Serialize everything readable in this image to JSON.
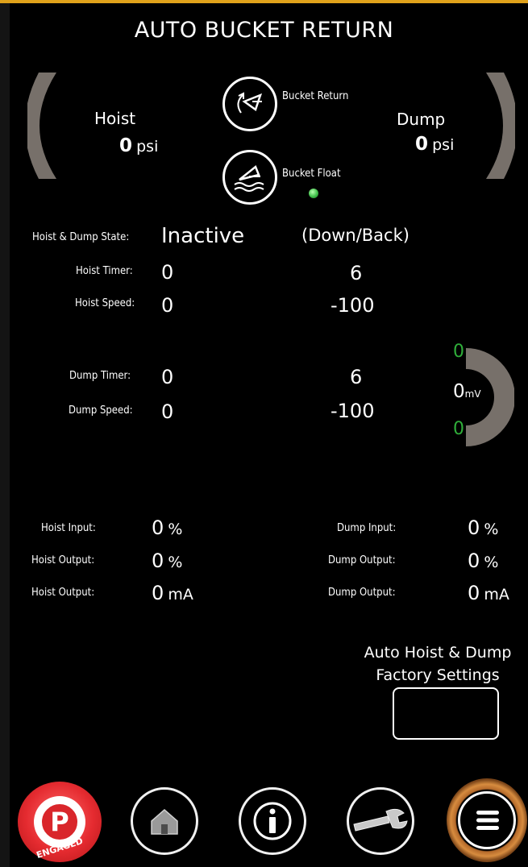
{
  "title": "AUTO BUCKET RETURN",
  "hoist": {
    "label": "Hoist",
    "pressure": "0",
    "unit": "psi"
  },
  "dump": {
    "label": "Dump",
    "pressure": "0",
    "unit": "psi"
  },
  "bucket_return": {
    "label": "Bucket Return"
  },
  "bucket_float": {
    "label": "Bucket Float",
    "indicator_color": "#3fc04a"
  },
  "state": {
    "label": "Hoist & Dump State:",
    "value": "Inactive",
    "direction": "(Down/Back)"
  },
  "hoist_timer": {
    "label": "Hoist Timer:",
    "value": "0",
    "setpoint": "6"
  },
  "hoist_speed": {
    "label": "Hoist Speed:",
    "value": "0",
    "setpoint": "-100"
  },
  "dump_timer": {
    "label": "Dump Timer:",
    "value": "0",
    "setpoint": "6"
  },
  "dump_speed": {
    "label": "Dump Speed:",
    "value": "0",
    "setpoint": "-100"
  },
  "mv_gauge": {
    "top": "0",
    "value": "0",
    "unit": "mV",
    "bottom": "0",
    "limit_color": "#2fae3a"
  },
  "io": {
    "hoist_input": {
      "label": "Hoist Input:",
      "value": "0",
      "unit": "%"
    },
    "hoist_output_pct": {
      "label": "Hoist Output:",
      "value": "0",
      "unit": "%"
    },
    "hoist_output_ma": {
      "label": "Hoist Output:",
      "value": "0",
      "unit": "mA"
    },
    "dump_input": {
      "label": "Dump Input:",
      "value": "0",
      "unit": "%"
    },
    "dump_output_pct": {
      "label": "Dump Output:",
      "value": "0",
      "unit": "%"
    },
    "dump_output_ma": {
      "label": "Dump Output:",
      "value": "0",
      "unit": "mA"
    }
  },
  "factory_settings": {
    "line1": "Auto Hoist & Dump",
    "line2": "Factory Settings"
  },
  "nav": {
    "park_letter": "P",
    "park_status": "ENGAGED",
    "park_color": "#d9262b",
    "menu_ring_color": "#b4692a"
  },
  "colors": {
    "gauge": "#77706a",
    "background": "#000000",
    "accent_top": "#e0a21b"
  }
}
